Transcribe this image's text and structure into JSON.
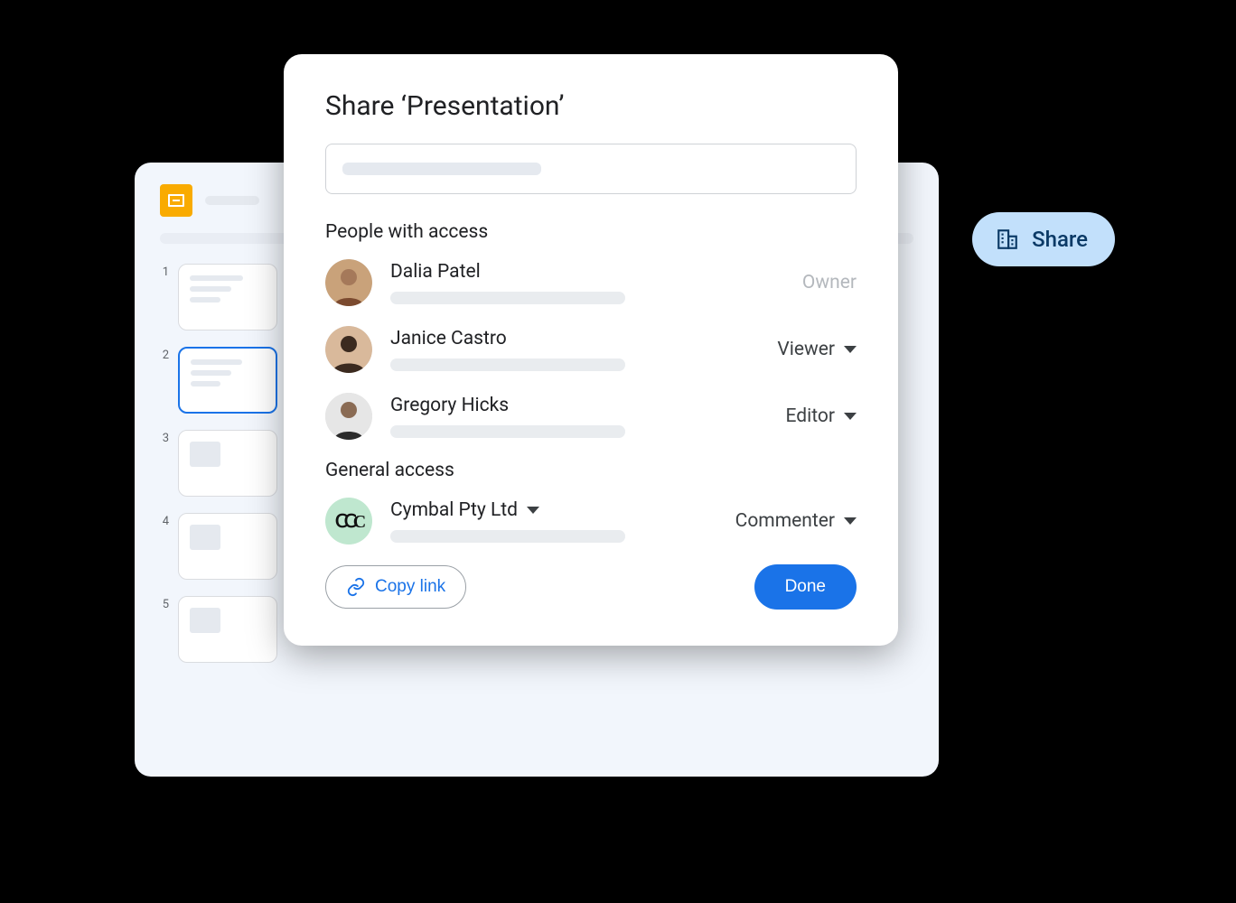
{
  "slides_bg": {
    "thumb_numbers": [
      "1",
      "2",
      "3",
      "4",
      "5"
    ],
    "selected_index": 1
  },
  "share_pill": {
    "label": "Share",
    "icon": "building-icon"
  },
  "modal": {
    "title": "Share ‘Presentation’",
    "search_placeholder": "",
    "people_section_label": "People with access",
    "people": [
      {
        "name": "Dalia Patel",
        "role": "Owner",
        "role_interactive": false
      },
      {
        "name": "Janice Castro",
        "role": "Viewer",
        "role_interactive": true
      },
      {
        "name": "Gregory Hicks",
        "role": "Editor",
        "role_interactive": true
      }
    ],
    "general_section_label": "General access",
    "general": {
      "org_name": "Cymbal Pty Ltd",
      "role": "Commenter"
    },
    "copy_link_label": "Copy link",
    "done_label": "Done"
  }
}
